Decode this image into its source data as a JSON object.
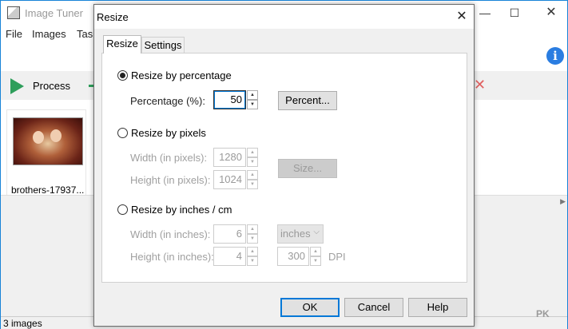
{
  "app": {
    "title": "Image Tuner",
    "minimize": "—",
    "maximize": "☐",
    "close": "✕"
  },
  "menu": [
    "File",
    "Images",
    "Task"
  ],
  "toolbar": {
    "process_label": "Process"
  },
  "thumbnail": {
    "caption": "brothers-17937..."
  },
  "status": {
    "text": "3 images"
  },
  "watermark": "PK",
  "dialog": {
    "title": "Resize",
    "close": "✕",
    "tabs": [
      {
        "label": "Resize"
      },
      {
        "label": "Settings"
      }
    ],
    "percentage": {
      "radio_label": "Resize by percentage",
      "field_label": "Percentage (%):",
      "value": "50",
      "button_label": "Percent..."
    },
    "pixels": {
      "radio_label": "Resize by pixels",
      "width_label": "Width (in pixels):",
      "width_value": "1280",
      "height_label": "Height (in pixels):",
      "height_value": "1024",
      "button_label": "Size..."
    },
    "inches": {
      "radio_label": "Resize by inches / cm",
      "width_label": "Width (in inches):",
      "width_value": "6",
      "height_label": "Height (in inches):",
      "height_value": "4",
      "unit_select": "inches",
      "dpi_value": "300",
      "dpi_label": "DPI"
    },
    "buttons": {
      "ok": "OK",
      "cancel": "Cancel",
      "help": "Help"
    }
  }
}
